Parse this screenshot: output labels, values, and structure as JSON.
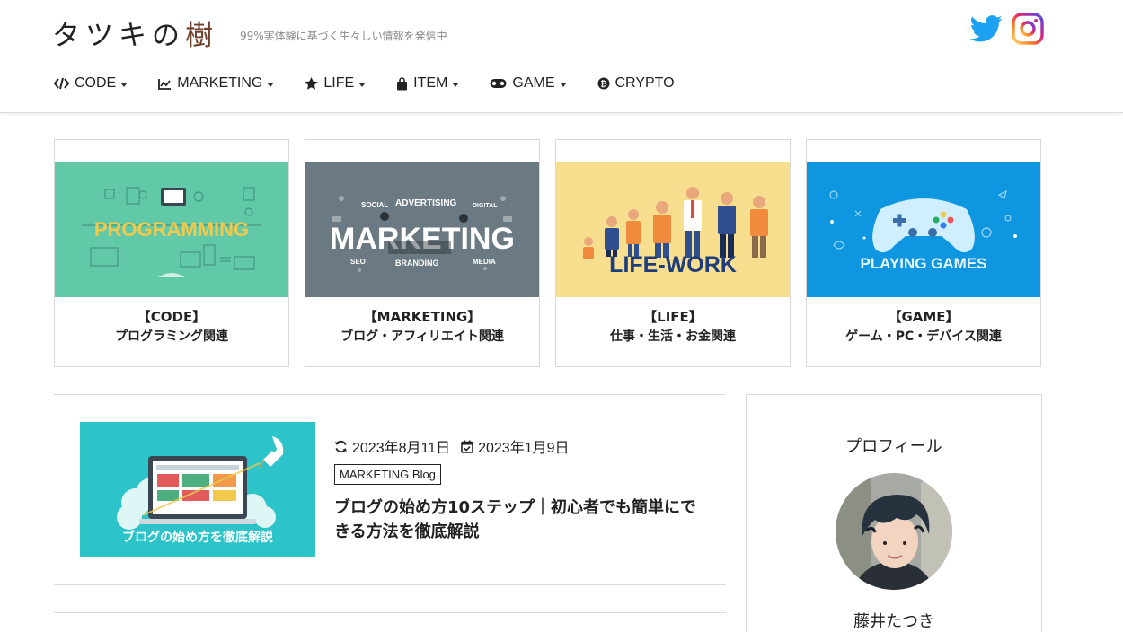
{
  "site": {
    "logo_main": "タツキの",
    "logo_accent": "樹",
    "tagline": "99%実体験に基づく生々しい情報を発信中"
  },
  "social": {
    "twitter_color": "#1da1f2",
    "instagram_colors": [
      "#feda75",
      "#fa7e1e",
      "#d62976",
      "#962fbf",
      "#4f5bd5"
    ]
  },
  "nav": [
    {
      "label": "CODE",
      "icon": "code-icon",
      "dropdown": true
    },
    {
      "label": "MARKETING",
      "icon": "chart-line-icon",
      "dropdown": true
    },
    {
      "label": "LIFE",
      "icon": "star-icon",
      "dropdown": true
    },
    {
      "label": "ITEM",
      "icon": "shopping-bag-icon",
      "dropdown": true
    },
    {
      "label": "GAME",
      "icon": "gamepad-icon",
      "dropdown": true
    },
    {
      "label": "CRYPTO",
      "icon": "bitcoin-icon",
      "dropdown": false
    }
  ],
  "categories": [
    {
      "title": "【CODE】",
      "subtitle": "プログラミング関連",
      "image_text": "PROGRAMMING",
      "bg": "#62c9a8"
    },
    {
      "title": "【MARKETING】",
      "subtitle": "ブログ・アフィリエイト関連",
      "image_text": "MARKETING",
      "bg": "#6b7a82"
    },
    {
      "title": "【LIFE】",
      "subtitle": "仕事・生活・お金関連",
      "image_text": "LIFE-WORK",
      "bg": "#f7df8f"
    },
    {
      "title": "【GAME】",
      "subtitle": "ゲーム・PC・デバイス関連",
      "image_text": "PLAYING GAMES",
      "bg": "#0e96e0"
    }
  ],
  "marketing_words": {
    "social": "SOCIAL",
    "advertising": "ADVERTISING",
    "digital": "DIGITAL",
    "seo": "SEO",
    "branding": "BRANDING",
    "media": "MEDIA"
  },
  "article": {
    "updated": "2023年8月11日",
    "published": "2023年1月9日",
    "category_tag": "MARKETING Blog",
    "title": "ブログの始め方10ステップ｜初心者でも簡単にできる方法を徹底解説",
    "thumb_text": "ブログの始め方を徹底解説",
    "thumb_bg": "#2cc3c9"
  },
  "sidebar": {
    "heading": "プロフィール",
    "name": "藤井たつき"
  }
}
